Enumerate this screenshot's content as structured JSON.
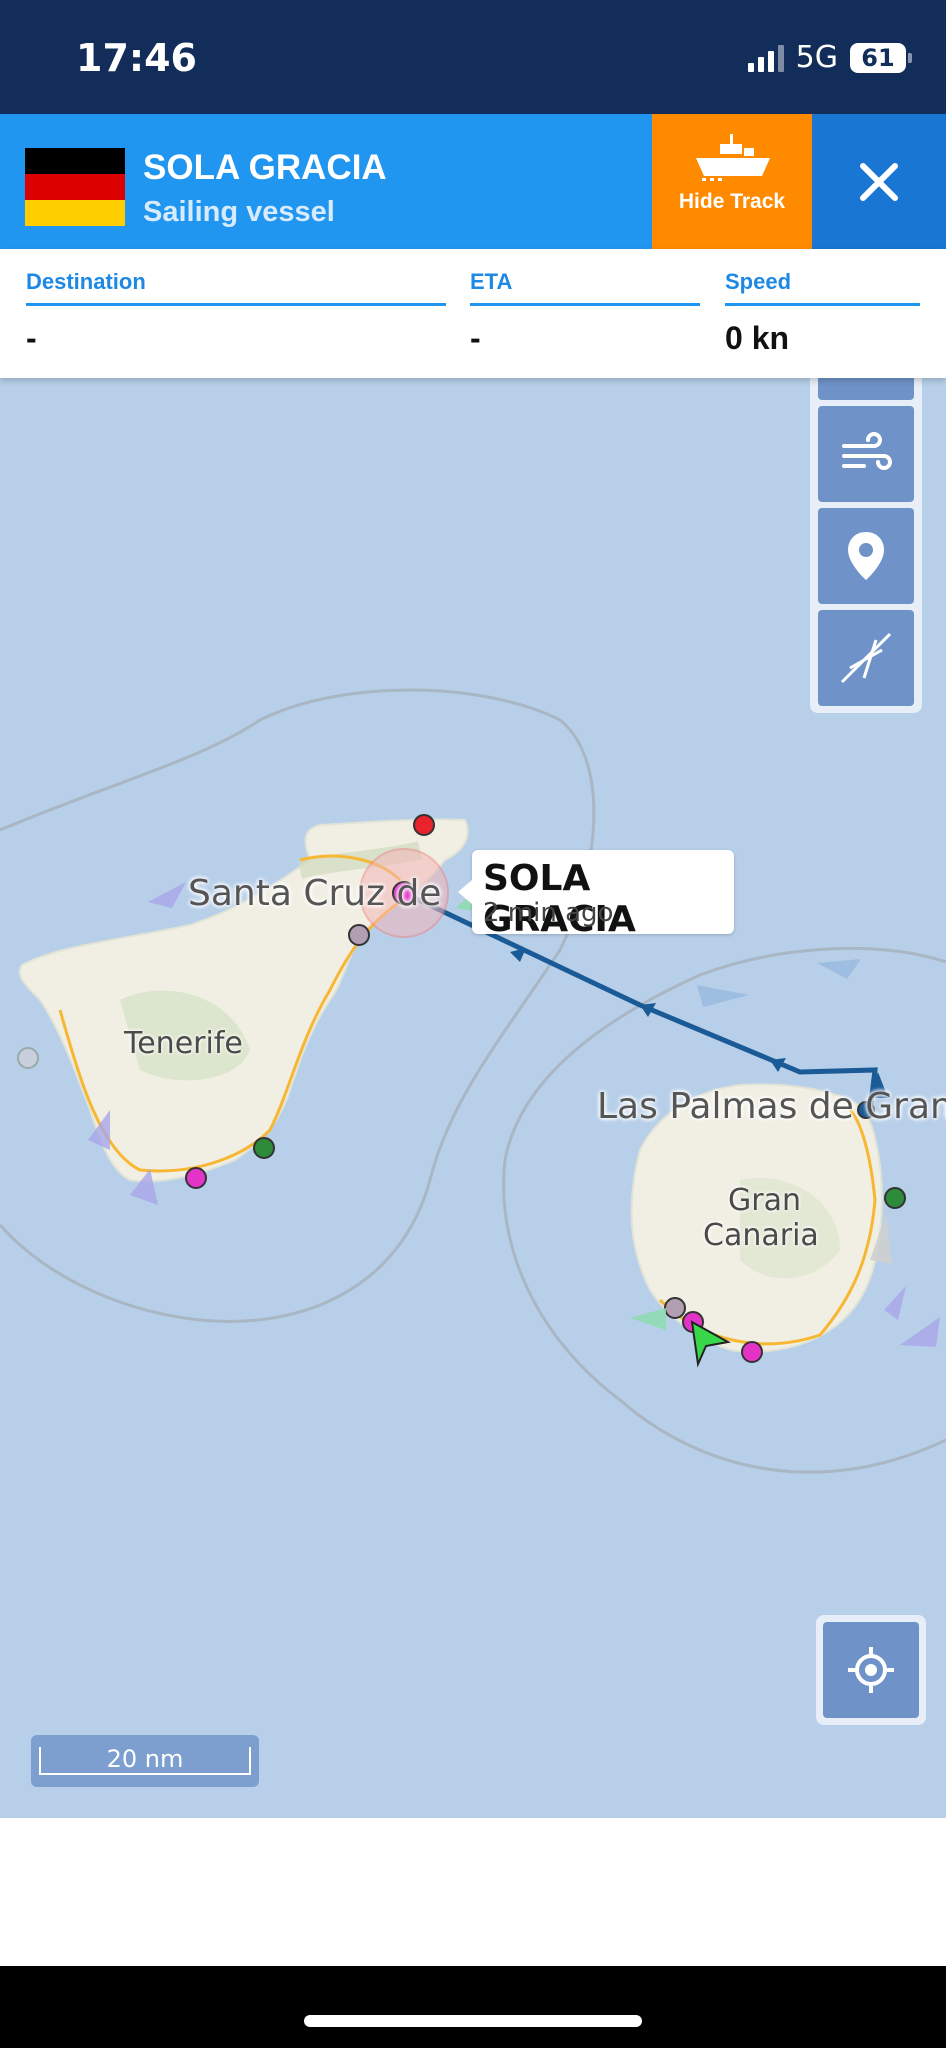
{
  "status_bar": {
    "time": "17:46",
    "network": "5G",
    "battery": "61"
  },
  "vessel": {
    "name": "SOLA GRACIA",
    "type": "Sailing vessel",
    "flag_colors": [
      "#000000",
      "#dd0000",
      "#ffce00"
    ]
  },
  "header_buttons": {
    "hide_track": "Hide Track",
    "close": "close-icon"
  },
  "info": {
    "destination_label": "Destination",
    "destination_value": "-",
    "eta_label": "ETA",
    "eta_value": "-",
    "speed_label": "Speed",
    "speed_value": "0 kn"
  },
  "map": {
    "vessel_label_name": "SOLA GRACIA",
    "vessel_label_time": "2 min ago",
    "places": {
      "santa_cruz": "Santa Cruz de",
      "tenerife": "Tenerife",
      "las_palmas": "Las Palmas de Gran",
      "gran": "Gran",
      "canaria": "Canaria"
    },
    "scale": "20 nm",
    "colors": {
      "sea": "#b7cfe9",
      "land": "#f2efe4",
      "track": "#1a5a96",
      "road": "#f7b733"
    }
  },
  "tools": [
    "wind-icon",
    "location-pin-icon",
    "compass-icon"
  ],
  "locate": "crosshair-icon"
}
